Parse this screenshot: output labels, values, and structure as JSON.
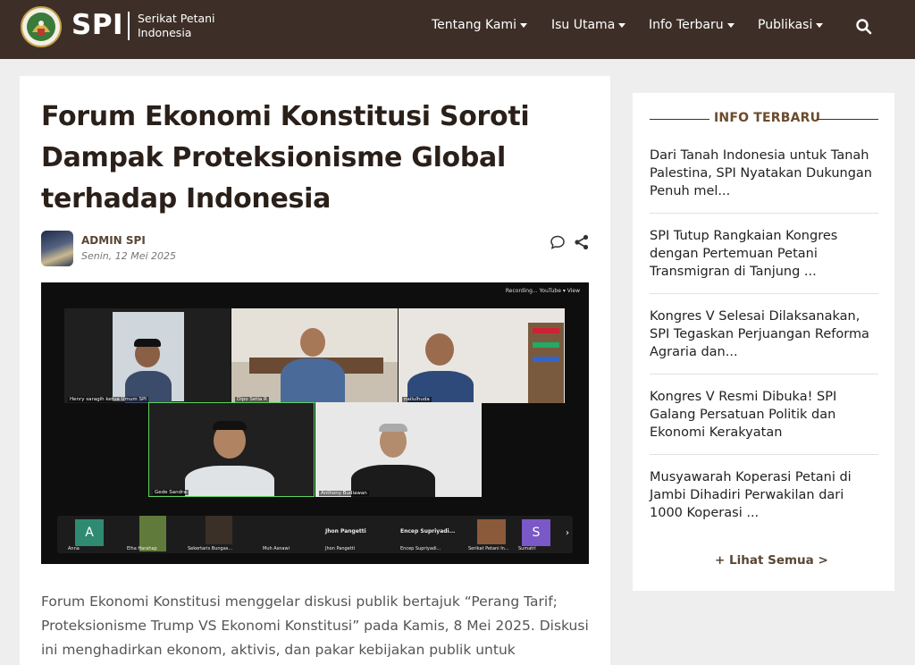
{
  "header": {
    "logo_text": "SPI",
    "logo_subtitle": "Serikat Petani Indonesia",
    "nav": [
      {
        "label": "Tentang Kami"
      },
      {
        "label": "Isu Utama"
      },
      {
        "label": "Info Terbaru"
      },
      {
        "label": "Publikasi"
      }
    ],
    "search_icon": "search-icon"
  },
  "article": {
    "title": "Forum Ekonomi Konstitusi Soroti Dampak Proteksionisme Global terhadap Indonesia",
    "author": "ADMIN SPI",
    "date": "Senin, 12 Mei 2025",
    "photo": {
      "toolbar": "Recording...   YouTube ▾     View",
      "participants": [
        "Henry saragih ketua Umum SPI",
        "Dipo Setia R",
        "nailulhuda",
        "Gede Sandra",
        "Anthony Budiawan"
      ],
      "strip": [
        {
          "avatar": "A",
          "name": "Anna"
        },
        {
          "avatar": "",
          "name": "Elha Harahap"
        },
        {
          "avatar": "",
          "name": "Sekertaris Bungas..."
        },
        {
          "avatar": "",
          "name": "Muh Asnawi"
        },
        {
          "avatar": "Jhon Pangetti",
          "name": "Jhon Pangetti"
        },
        {
          "avatar": "Encep Supriyadi...",
          "name": "Encep Supriyadi..."
        },
        {
          "avatar": "",
          "name": "Serikat Petani In..."
        },
        {
          "avatar": "S",
          "name": "Sumatri"
        }
      ]
    },
    "body": "Forum Ekonomi Konstitusi menggelar diskusi publik bertajuk “Perang Tarif; Proteksionisme Trump VS Ekonomi Konstitusi” pada Kamis, 8 Mei 2025. Diskusi ini menghadirkan ekonom, aktivis, dan pakar kebijakan publik untuk membahas"
  },
  "sidebar": {
    "title": "INFO TERBARU",
    "items": [
      {
        "text": "Dari Tanah Indonesia untuk Tanah Palestina, SPI Nyatakan Dukungan Penuh mel..."
      },
      {
        "text": "SPI Tutup Rangkaian Kongres dengan Pertemuan Petani Transmigran di Tanjung ..."
      },
      {
        "text": "Kongres V Selesai Dilaksanakan, SPI Tegaskan Perjuangan Reforma Agraria dan..."
      },
      {
        "text": "Kongres V Resmi Dibuka! SPI Galang Persatuan Politik dan Ekonomi Kerakyatan"
      },
      {
        "text": "Musyawarah Koperasi Petani di Jambi Dihadiri Perwakilan dari 1000 Koperasi ..."
      }
    ],
    "see_all": "+ Lihat Semua >"
  },
  "colors": {
    "header_bg": "#3d2f27",
    "accent_brown": "#6b4a2c",
    "page_bg": "#eeeeee"
  }
}
